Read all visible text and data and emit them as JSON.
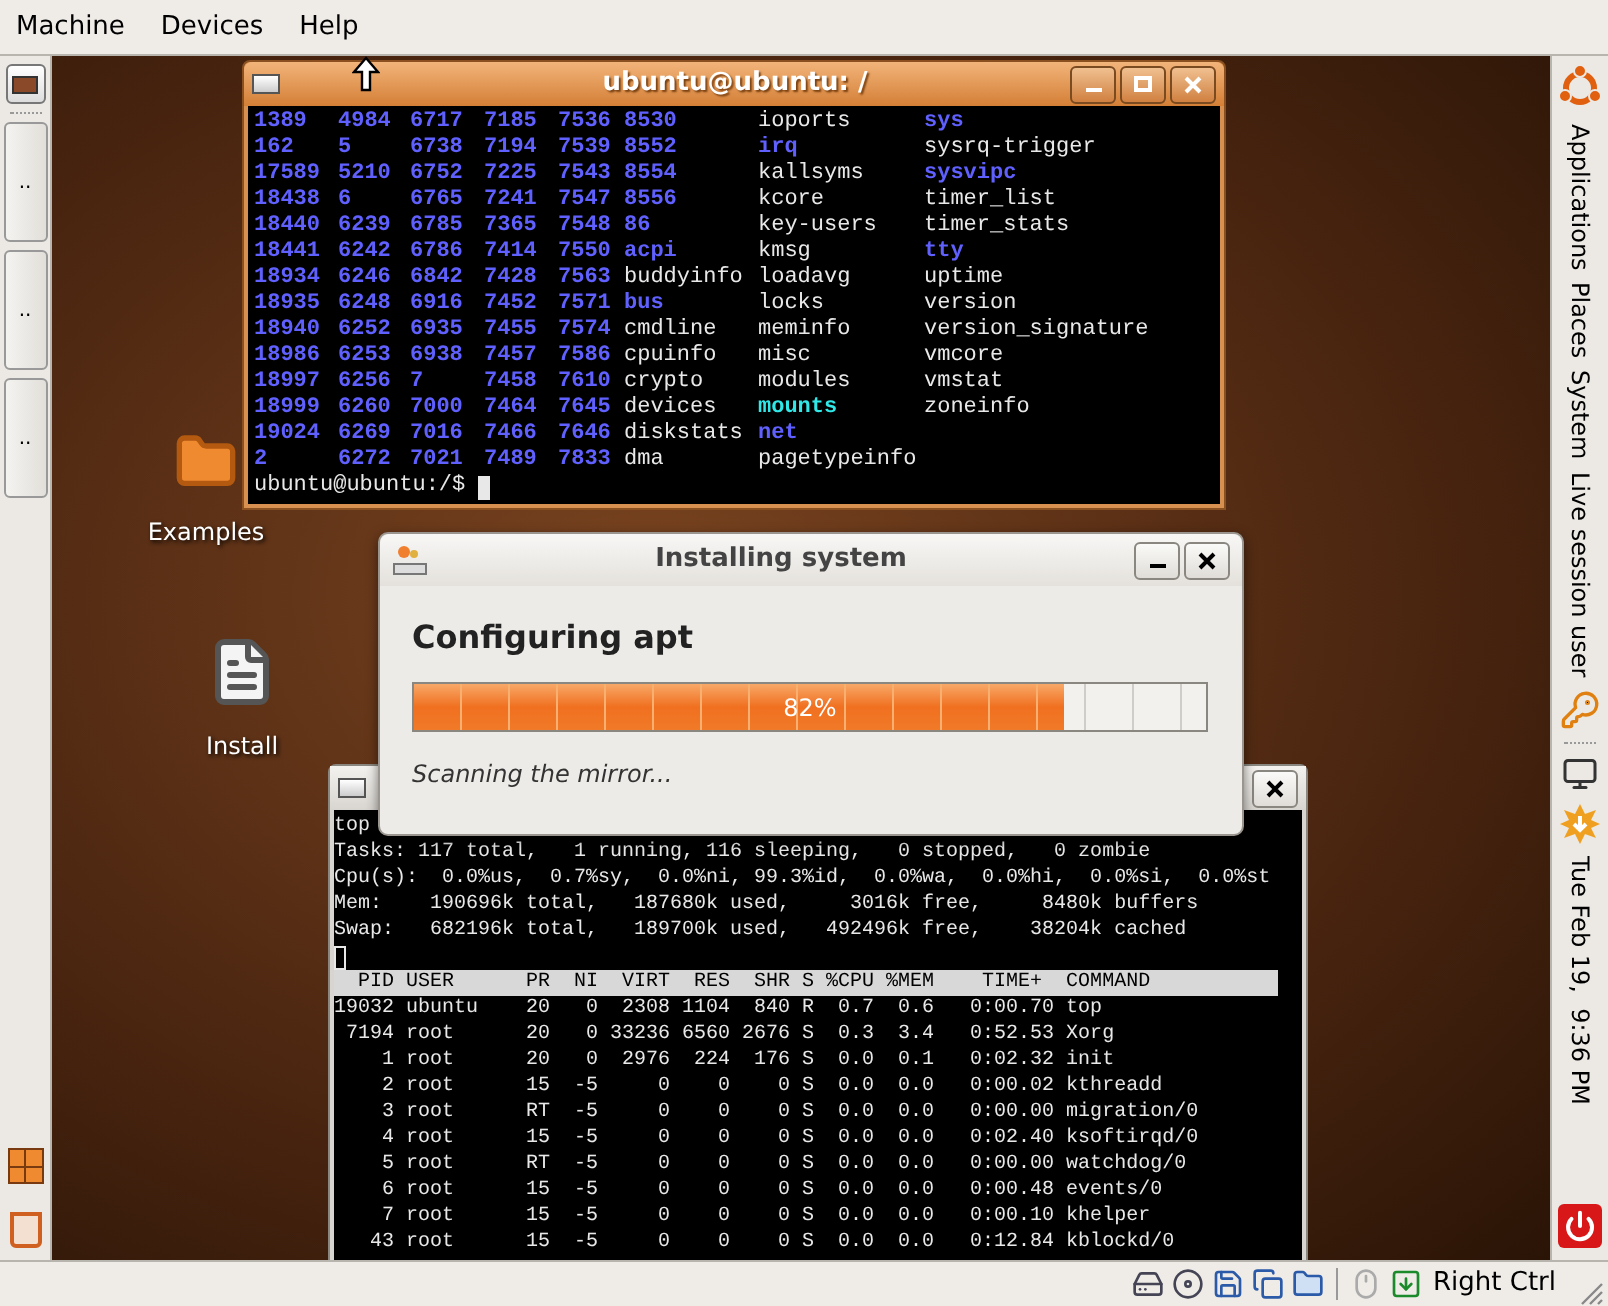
{
  "menu_bar": {
    "items": [
      "Machine",
      "Devices",
      "Help"
    ]
  },
  "left_panel": {
    "window_buttons": [
      "..",
      "..",
      ".."
    ]
  },
  "desktop": {
    "icons": [
      {
        "label": "Examples",
        "kind": "folder"
      },
      {
        "label": "Install",
        "kind": "document"
      }
    ]
  },
  "terminal_window": {
    "title": "ubuntu@ubuntu: /",
    "listing": [
      [
        {
          "name": "1389",
          "kind": "dir"
        },
        {
          "name": "4984",
          "kind": "dir"
        },
        {
          "name": "6717",
          "kind": "dir"
        },
        {
          "name": "7185",
          "kind": "dir"
        },
        {
          "name": "7536",
          "kind": "dir"
        },
        {
          "name": "8530",
          "kind": "dir"
        },
        {
          "name": "ioports",
          "kind": "file"
        },
        {
          "name": "sys",
          "kind": "dir"
        }
      ],
      [
        {
          "name": "162",
          "kind": "dir"
        },
        {
          "name": "5",
          "kind": "dir"
        },
        {
          "name": "6738",
          "kind": "dir"
        },
        {
          "name": "7194",
          "kind": "dir"
        },
        {
          "name": "7539",
          "kind": "dir"
        },
        {
          "name": "8552",
          "kind": "dir"
        },
        {
          "name": "irq",
          "kind": "dir"
        },
        {
          "name": "sysrq-trigger",
          "kind": "file"
        }
      ],
      [
        {
          "name": "17589",
          "kind": "dir"
        },
        {
          "name": "5210",
          "kind": "dir"
        },
        {
          "name": "6752",
          "kind": "dir"
        },
        {
          "name": "7225",
          "kind": "dir"
        },
        {
          "name": "7543",
          "kind": "dir"
        },
        {
          "name": "8554",
          "kind": "dir"
        },
        {
          "name": "kallsyms",
          "kind": "file"
        },
        {
          "name": "sysvipc",
          "kind": "dir"
        }
      ],
      [
        {
          "name": "18438",
          "kind": "dir"
        },
        {
          "name": "6",
          "kind": "dir"
        },
        {
          "name": "6765",
          "kind": "dir"
        },
        {
          "name": "7241",
          "kind": "dir"
        },
        {
          "name": "7547",
          "kind": "dir"
        },
        {
          "name": "8556",
          "kind": "dir"
        },
        {
          "name": "kcore",
          "kind": "file"
        },
        {
          "name": "timer_list",
          "kind": "file"
        }
      ],
      [
        {
          "name": "18440",
          "kind": "dir"
        },
        {
          "name": "6239",
          "kind": "dir"
        },
        {
          "name": "6785",
          "kind": "dir"
        },
        {
          "name": "7365",
          "kind": "dir"
        },
        {
          "name": "7548",
          "kind": "dir"
        },
        {
          "name": "86",
          "kind": "dir"
        },
        {
          "name": "key-users",
          "kind": "file"
        },
        {
          "name": "timer_stats",
          "kind": "file"
        }
      ],
      [
        {
          "name": "18441",
          "kind": "dir"
        },
        {
          "name": "6242",
          "kind": "dir"
        },
        {
          "name": "6786",
          "kind": "dir"
        },
        {
          "name": "7414",
          "kind": "dir"
        },
        {
          "name": "7550",
          "kind": "dir"
        },
        {
          "name": "acpi",
          "kind": "dir"
        },
        {
          "name": "kmsg",
          "kind": "file"
        },
        {
          "name": "tty",
          "kind": "dir"
        }
      ],
      [
        {
          "name": "18934",
          "kind": "dir"
        },
        {
          "name": "6246",
          "kind": "dir"
        },
        {
          "name": "6842",
          "kind": "dir"
        },
        {
          "name": "7428",
          "kind": "dir"
        },
        {
          "name": "7563",
          "kind": "dir"
        },
        {
          "name": "buddyinfo",
          "kind": "file"
        },
        {
          "name": "loadavg",
          "kind": "file"
        },
        {
          "name": "uptime",
          "kind": "file"
        }
      ],
      [
        {
          "name": "18935",
          "kind": "dir"
        },
        {
          "name": "6248",
          "kind": "dir"
        },
        {
          "name": "6916",
          "kind": "dir"
        },
        {
          "name": "7452",
          "kind": "dir"
        },
        {
          "name": "7571",
          "kind": "dir"
        },
        {
          "name": "bus",
          "kind": "dir"
        },
        {
          "name": "locks",
          "kind": "file"
        },
        {
          "name": "version",
          "kind": "file"
        }
      ],
      [
        {
          "name": "18940",
          "kind": "dir"
        },
        {
          "name": "6252",
          "kind": "dir"
        },
        {
          "name": "6935",
          "kind": "dir"
        },
        {
          "name": "7455",
          "kind": "dir"
        },
        {
          "name": "7574",
          "kind": "dir"
        },
        {
          "name": "cmdline",
          "kind": "file"
        },
        {
          "name": "meminfo",
          "kind": "file"
        },
        {
          "name": "version_signature",
          "kind": "file"
        }
      ],
      [
        {
          "name": "18986",
          "kind": "dir"
        },
        {
          "name": "6253",
          "kind": "dir"
        },
        {
          "name": "6938",
          "kind": "dir"
        },
        {
          "name": "7457",
          "kind": "dir"
        },
        {
          "name": "7586",
          "kind": "dir"
        },
        {
          "name": "cpuinfo",
          "kind": "file"
        },
        {
          "name": "misc",
          "kind": "file"
        },
        {
          "name": "vmcore",
          "kind": "file"
        }
      ],
      [
        {
          "name": "18997",
          "kind": "dir"
        },
        {
          "name": "6256",
          "kind": "dir"
        },
        {
          "name": "7",
          "kind": "dir"
        },
        {
          "name": "7458",
          "kind": "dir"
        },
        {
          "name": "7610",
          "kind": "dir"
        },
        {
          "name": "crypto",
          "kind": "file"
        },
        {
          "name": "modules",
          "kind": "file"
        },
        {
          "name": "vmstat",
          "kind": "file"
        }
      ],
      [
        {
          "name": "18999",
          "kind": "dir"
        },
        {
          "name": "6260",
          "kind": "dir"
        },
        {
          "name": "7000",
          "kind": "dir"
        },
        {
          "name": "7464",
          "kind": "dir"
        },
        {
          "name": "7645",
          "kind": "dir"
        },
        {
          "name": "devices",
          "kind": "file"
        },
        {
          "name": "mounts",
          "kind": "link"
        },
        {
          "name": "zoneinfo",
          "kind": "file"
        }
      ],
      [
        {
          "name": "19024",
          "kind": "dir"
        },
        {
          "name": "6269",
          "kind": "dir"
        },
        {
          "name": "7016",
          "kind": "dir"
        },
        {
          "name": "7466",
          "kind": "dir"
        },
        {
          "name": "7646",
          "kind": "dir"
        },
        {
          "name": "diskstats",
          "kind": "file"
        },
        {
          "name": "net",
          "kind": "dir"
        }
      ],
      [
        {
          "name": "2",
          "kind": "dir"
        },
        {
          "name": "6272",
          "kind": "dir"
        },
        {
          "name": "7021",
          "kind": "dir"
        },
        {
          "name": "7489",
          "kind": "dir"
        },
        {
          "name": "7833",
          "kind": "dir"
        },
        {
          "name": "dma",
          "kind": "file"
        },
        {
          "name": "pagetypeinfo",
          "kind": "file"
        }
      ]
    ],
    "prompt": "ubuntu@ubuntu:/$"
  },
  "installer_dialog": {
    "title": "Installing system",
    "heading": "Configuring apt",
    "progress": {
      "level": 0.82,
      "reading": "82%"
    },
    "status": "Scanning the mirror..."
  },
  "top_window": {
    "summary": [
      "top",
      "Tasks: 117 total,   1 running, 116 sleeping,   0 stopped,   0 zombie",
      "Cpu(s):  0.0%us,  0.7%sy,  0.0%ni, 99.3%id,  0.0%wa,  0.0%hi,  0.0%si,  0.0%st",
      "Mem:    190696k total,   187680k used,     3016k free,     8480k buffers",
      "Swap:   682196k total,   189700k used,   492496k free,    38204k cached"
    ],
    "header": "  PID USER      PR  NI  VIRT  RES  SHR S %CPU %MEM    TIME+  COMMAND",
    "processes": [
      "19032 ubuntu    20   0  2308 1104  840 R  0.7  0.6   0:00.70 top",
      " 7194 root      20   0 33236 6560 2676 S  0.3  3.4   0:52.53 Xorg",
      "    1 root      20   0  2976  224  176 S  0.0  0.1   0:02.32 init",
      "    2 root      15  -5     0    0    0 S  0.0  0.0   0:00.02 kthreadd",
      "    3 root      RT  -5     0    0    0 S  0.0  0.0   0:00.00 migration/0",
      "    4 root      15  -5     0    0    0 S  0.0  0.0   0:02.40 ksoftirqd/0",
      "    5 root      RT  -5     0    0    0 S  0.0  0.0   0:00.00 watchdog/0",
      "    6 root      15  -5     0    0    0 S  0.0  0.0   0:00.48 events/0",
      "    7 root      15  -5     0    0    0 S  0.0  0.0   0:00.10 khelper",
      "   43 root      15  -5     0    0    0 S  0.0  0.0   0:12.84 kblockd/0"
    ]
  },
  "right_panel": {
    "menus": [
      "Applications",
      "Places",
      "System"
    ],
    "user": "Live session user",
    "clock": "Tue Feb 19,  9:36 PM"
  },
  "status_bar": {
    "host_key": "Right Ctrl"
  }
}
